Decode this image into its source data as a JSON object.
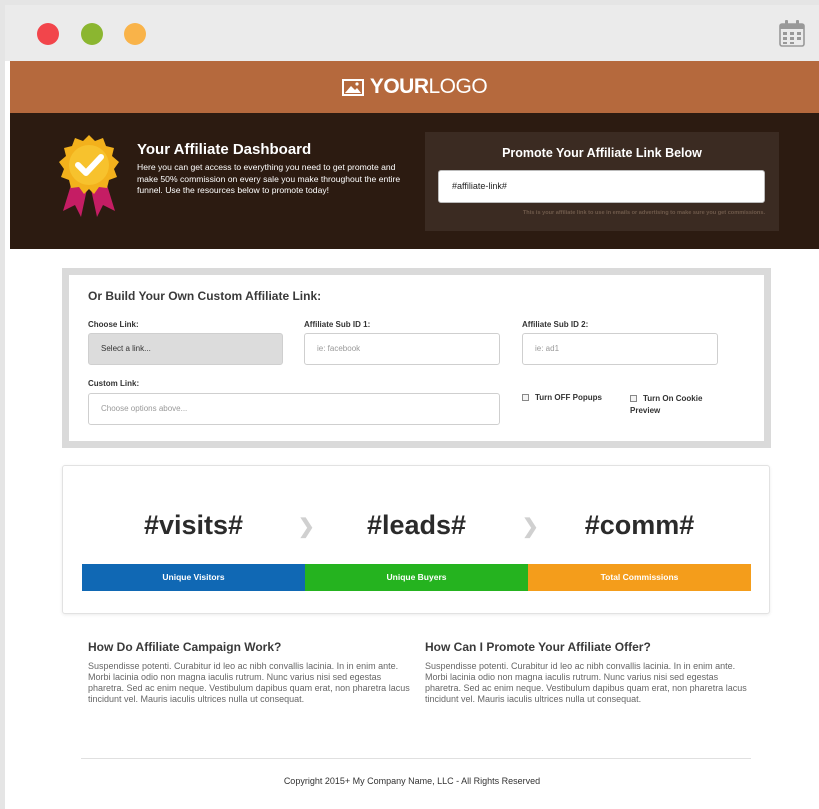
{
  "window": {
    "controls": [
      "close",
      "minimize",
      "maximize"
    ],
    "calendar_icon": "calendar-icon"
  },
  "header": {
    "logo_bold": "YOUR",
    "logo_thin": "LOGO",
    "logo_icon": "image-icon",
    "color": "#b5693d"
  },
  "hero": {
    "badge_icon": "award-badge-icon",
    "title": "Your Affiliate Dashboard",
    "description": "Here you can get access to everything you need to get promote and make 50% commission on every sale you make throughout the entire funnel. Use the resources below to promote today!",
    "promote": {
      "title": "Promote Your Affiliate Link Below",
      "link_value": "#affiliate-link#",
      "note": "This is your affiliate link to use in emails or advertising to make sure you get commissions."
    }
  },
  "builder": {
    "title": "Or Build Your Own Custom Affiliate Link:",
    "choose_link": {
      "label": "Choose Link:",
      "value": "Select a link..."
    },
    "sub_id_1": {
      "label": "Affiliate Sub ID 1:",
      "placeholder": "ie: facebook"
    },
    "sub_id_2": {
      "label": "Affiliate Sub ID 2:",
      "placeholder": "ie: ad1"
    },
    "custom_link": {
      "label": "Custom Link:",
      "placeholder": "Choose options above..."
    },
    "popups_toggle": "Turn OFF Popups",
    "cookie_toggle_line1": "Turn On Cookie",
    "cookie_toggle_line2": "Preview"
  },
  "stats": [
    {
      "value": "#visits#",
      "label": "Unique Visitors",
      "color": "#1068b4"
    },
    {
      "value": "#leads#",
      "label": "Unique Buyers",
      "color": "#25b31f"
    },
    {
      "value": "#comm#",
      "label": "Total Commissions",
      "color": "#f49d1b"
    }
  ],
  "info": [
    {
      "title": "How Do Affiliate Campaign Work?",
      "text": "Suspendisse potenti. Curabitur id leo ac nibh convallis lacinia. In in enim ante. Morbi lacinia odio non magna iaculis rutrum. Nunc varius nisi sed egestas pharetra. Sed ac enim neque. Vestibulum dapibus quam erat, non pharetra lacus tincidunt vel. Mauris iaculis ultrices nulla ut consequat."
    },
    {
      "title": "How Can I Promote Your Affiliate Offer?",
      "text": "Suspendisse potenti. Curabitur id leo ac nibh convallis lacinia. In in enim ante. Morbi lacinia odio non magna iaculis rutrum. Nunc varius nisi sed egestas pharetra. Sed ac enim neque. Vestibulum dapibus quam erat, non pharetra lacus tincidunt vel. Mauris iaculis ultrices nulla ut consequat."
    }
  ],
  "footer": {
    "copyright": "Copyright 2015+ My Company Name, LLC - All Rights Reserved"
  }
}
